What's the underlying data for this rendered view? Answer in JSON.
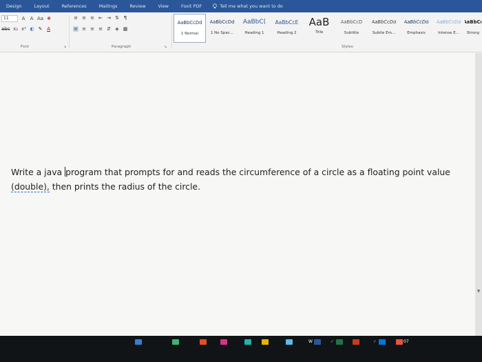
{
  "ribbon_tabs": [
    "Design",
    "Layout",
    "References",
    "Mailings",
    "Review",
    "View",
    "Foxit PDF"
  ],
  "tell_me": "Tell me what you want to do",
  "font": {
    "size": "11"
  },
  "font_row1_controls": [
    "A",
    "A",
    "Aa",
    "✔",
    "☰",
    "☰",
    "☰"
  ],
  "font_row2_controls": [
    "x₂",
    "x²",
    "A",
    "ab",
    "A"
  ],
  "group_labels": {
    "font": "Font",
    "paragraph": "Paragraph",
    "styles": "Styles"
  },
  "paragraph_marks": [
    "¶"
  ],
  "styles": [
    {
      "sample": "AaBbCcDd",
      "name": "1 Normal",
      "selected": true
    },
    {
      "sample": "AaBbCcDd",
      "name": "1 No Spac...",
      "selected": false
    },
    {
      "sample": "AaBbC(",
      "name": "Heading 1",
      "selected": false
    },
    {
      "sample": "AaBbCcE",
      "name": "Heading 2",
      "selected": false
    },
    {
      "sample": "AaB",
      "name": "Title",
      "selected": false
    },
    {
      "sample": "AaBbCcD",
      "name": "Subtitle",
      "selected": false
    },
    {
      "sample": "AaBbCcDd",
      "name": "Subtle Em...",
      "selected": false
    },
    {
      "sample": "AaBbCcDd",
      "name": "Emphasis",
      "selected": false
    },
    {
      "sample": "AaBbCcDd",
      "name": "Intense E...",
      "selected": false
    },
    {
      "sample": "AaBbCc",
      "name": "Strong",
      "selected": false
    }
  ],
  "document": {
    "text_before_cursor": "Write a java ",
    "text_after_cursor": "program that prompts for and reads the circumference of a circle as a floating point value ",
    "squiggle_text": "(double),",
    "text_end": " then prints the radius of the circle."
  },
  "taskbar": {
    "labels": [
      "W",
      "✓",
      "✓",
      "07"
    ]
  }
}
